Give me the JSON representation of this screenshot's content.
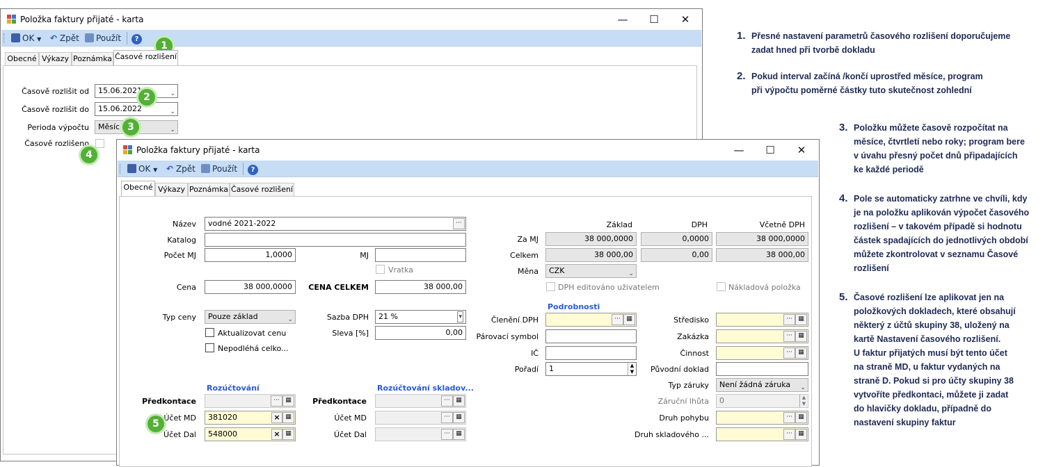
{
  "win1": {
    "title": "Položka faktury přijaté - karta",
    "toolbar": {
      "ok": "OK",
      "back": "Zpět",
      "apply": "Použít",
      "help": "?"
    },
    "tabs": [
      "Obecné",
      "Výkazy",
      "Poznámka",
      "Časové rozlišení"
    ],
    "fields": {
      "from_label": "Časově rozlišit od",
      "from_value": "15.06.2021",
      "to_label": "Časově rozlišit do",
      "to_value": "15.06.2022",
      "period_label": "Perioda výpočtu",
      "period_value": "Měsíc",
      "done_label": "Časově rozlišeno"
    }
  },
  "win2": {
    "title": "Položka faktury přijaté - karta",
    "toolbar": {
      "ok": "OK",
      "back": "Zpět",
      "apply": "Použít",
      "help": "?"
    },
    "tabs": [
      "Obecné",
      "Výkazy",
      "Poznámka",
      "Časové rozlišení"
    ],
    "left": {
      "nazev_label": "Název",
      "nazev_value": "vodné 2021-2022",
      "katalog_label": "Katalog",
      "katalog_value": "",
      "pocet_label": "Počet MJ",
      "pocet_value": "1,0000",
      "mj_label": "MJ",
      "mj_value": "",
      "vratka_label": "Vratka",
      "cena_label": "Cena",
      "cena_value": "38 000,0000",
      "cena_celkem_label": "CENA CELKEM",
      "cena_celkem_value": "38 000,00",
      "typ_ceny_label": "Typ ceny",
      "typ_ceny_value": "Pouze základ",
      "sazba_label": "Sazba DPH",
      "sazba_value": "21 %",
      "akt_label": "Aktualizovat cenu",
      "sleva_label": "Sleva [%]",
      "sleva_value": "0,00",
      "nepod_label": "Nepodléhá celko..."
    },
    "rozuct": {
      "title": "Rozúčtování",
      "title2": "Rozúčtování skladov...",
      "predkontace_label": "Předkontace",
      "ucet_md_label": "Účet MD",
      "ucet_md_value": "381020",
      "ucet_dal_label": "Účet Dal",
      "ucet_dal_value": "548000"
    },
    "prices": {
      "h_zaklad": "Základ",
      "h_dph": "DPH",
      "h_vcetne": "Včetně DPH",
      "za_mj_label": "Za MJ",
      "za_mj_zaklad": "38 000,0000",
      "za_mj_dph": "0,0000",
      "za_mj_vcetne": "38 000,0000",
      "celkem_label": "Celkem",
      "celkem_zaklad": "38 000,00",
      "celkem_dph": "0,00",
      "celkem_vcetne": "38 000,00",
      "mena_label": "Měna",
      "mena_value": "CZK",
      "dph_edit_label": "DPH editováno uživatelem",
      "nakl_label": "Nákladová položka"
    },
    "podrobnosti": {
      "title": "Podrobnosti",
      "cleneni_label": "Členění DPH",
      "parovaci_label": "Párovací symbol",
      "ic_label": "IČ",
      "poradi_label": "Pořadí",
      "poradi_value": "1",
      "stredisko_label": "Středisko",
      "zakazka_label": "Zakázka",
      "cinnost_label": "Činnost",
      "puvodni_label": "Původní doklad",
      "typ_zaruky_label": "Typ záruky",
      "typ_zaruky_value": "Není žádná záruka",
      "zarucni_label": "Záruční lhůta",
      "zarucni_value": "0",
      "druh_pohybu_label": "Druh pohybu",
      "druh_skl_label": "Druh skladového ..."
    }
  },
  "badges": [
    "1",
    "2",
    "3",
    "4",
    "5"
  ],
  "notes": [
    {
      "num": "1.",
      "lines": [
        "Přesné nastavení parametrů časového rozlišení doporučujeme",
        "zadat hned při tvorbě dokladu"
      ]
    },
    {
      "num": "2.",
      "lines": [
        "Pokud interval začíná /končí uprostřed měsíce, program",
        "při výpočtu poměrné částky tuto skutečnost zohlední"
      ]
    },
    {
      "num": "3.",
      "lines": [
        "Položku můžete časově rozpočítat na",
        "měsíce, čtvrtletí nebo roky; program bere",
        "v úvahu přesný počet dnů připadajících",
        "ke každé periodě"
      ]
    },
    {
      "num": "4.",
      "lines": [
        "Pole se automaticky zatrhne ve chvíli, kdy",
        "je na položku aplikován výpočet časového",
        "rozlišení – v takovém případě si hodnotu",
        "částek spadajících do jednotlivých období",
        "můžete zkontrolovat v seznamu Časové",
        "rozlišení"
      ]
    },
    {
      "num": "5.",
      "lines": [
        "Časové rozlišení lze aplikovat jen na",
        "položkových dokladech, které obsahují",
        "některý z účtů skupiny 38, uložený na",
        "kartě Nastavení časového rozlišení.",
        "U faktur přijatých musí být tento účet",
        "na straně MD, u faktur vydaných na",
        "straně D. Pokud si pro účty skupiny 38",
        "vytvoříte předkontaci, můžete ji zadat",
        "do hlavičky dokladu, případně do",
        "nastavení skupiny faktur"
      ]
    }
  ],
  "colors": {
    "badge": "#52b135",
    "toolbar": "#c7dcf5",
    "note_text": "#1e2a55",
    "section_blue": "#2a5ad6",
    "field_yellow": "#fffbd4"
  }
}
